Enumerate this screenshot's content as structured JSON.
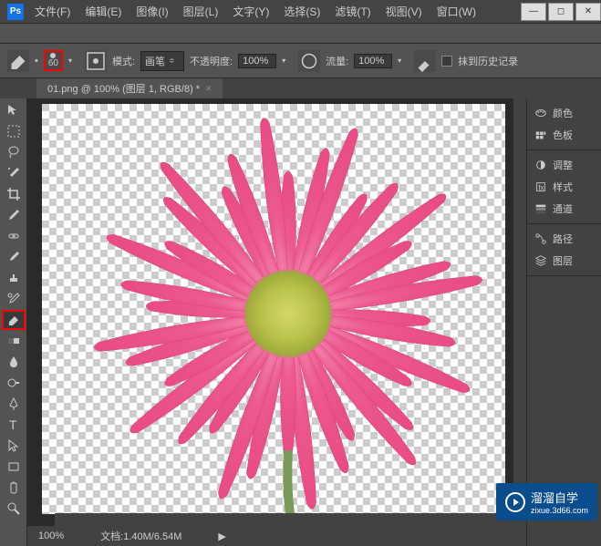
{
  "app": {
    "logo": "Ps"
  },
  "menu": {
    "file": "文件(F)",
    "edit": "编辑(E)",
    "image": "图像(I)",
    "layer": "图层(L)",
    "type": "文字(Y)",
    "select": "选择(S)",
    "filter": "滤镜(T)",
    "view": "视图(V)",
    "window": "窗口(W)"
  },
  "options": {
    "brush_size": "60",
    "mode_label": "模式:",
    "mode_value": "画笔",
    "opacity_label": "不透明度:",
    "opacity_value": "100%",
    "flow_label": "流量:",
    "flow_value": "100%",
    "history_label": "抹到历史记录"
  },
  "document": {
    "tab_title": "01.png @ 100% (图层 1, RGB/8) *"
  },
  "status": {
    "zoom": "100%",
    "doc_info": "文档:1.40M/6.54M"
  },
  "panels": {
    "color": "颜色",
    "swatches": "色板",
    "adjustments": "调整",
    "styles": "样式",
    "channels": "通道",
    "paths": "路径",
    "layers": "图层"
  },
  "watermark": {
    "text": "溜溜自学",
    "url": "zixue.3d66.com"
  }
}
